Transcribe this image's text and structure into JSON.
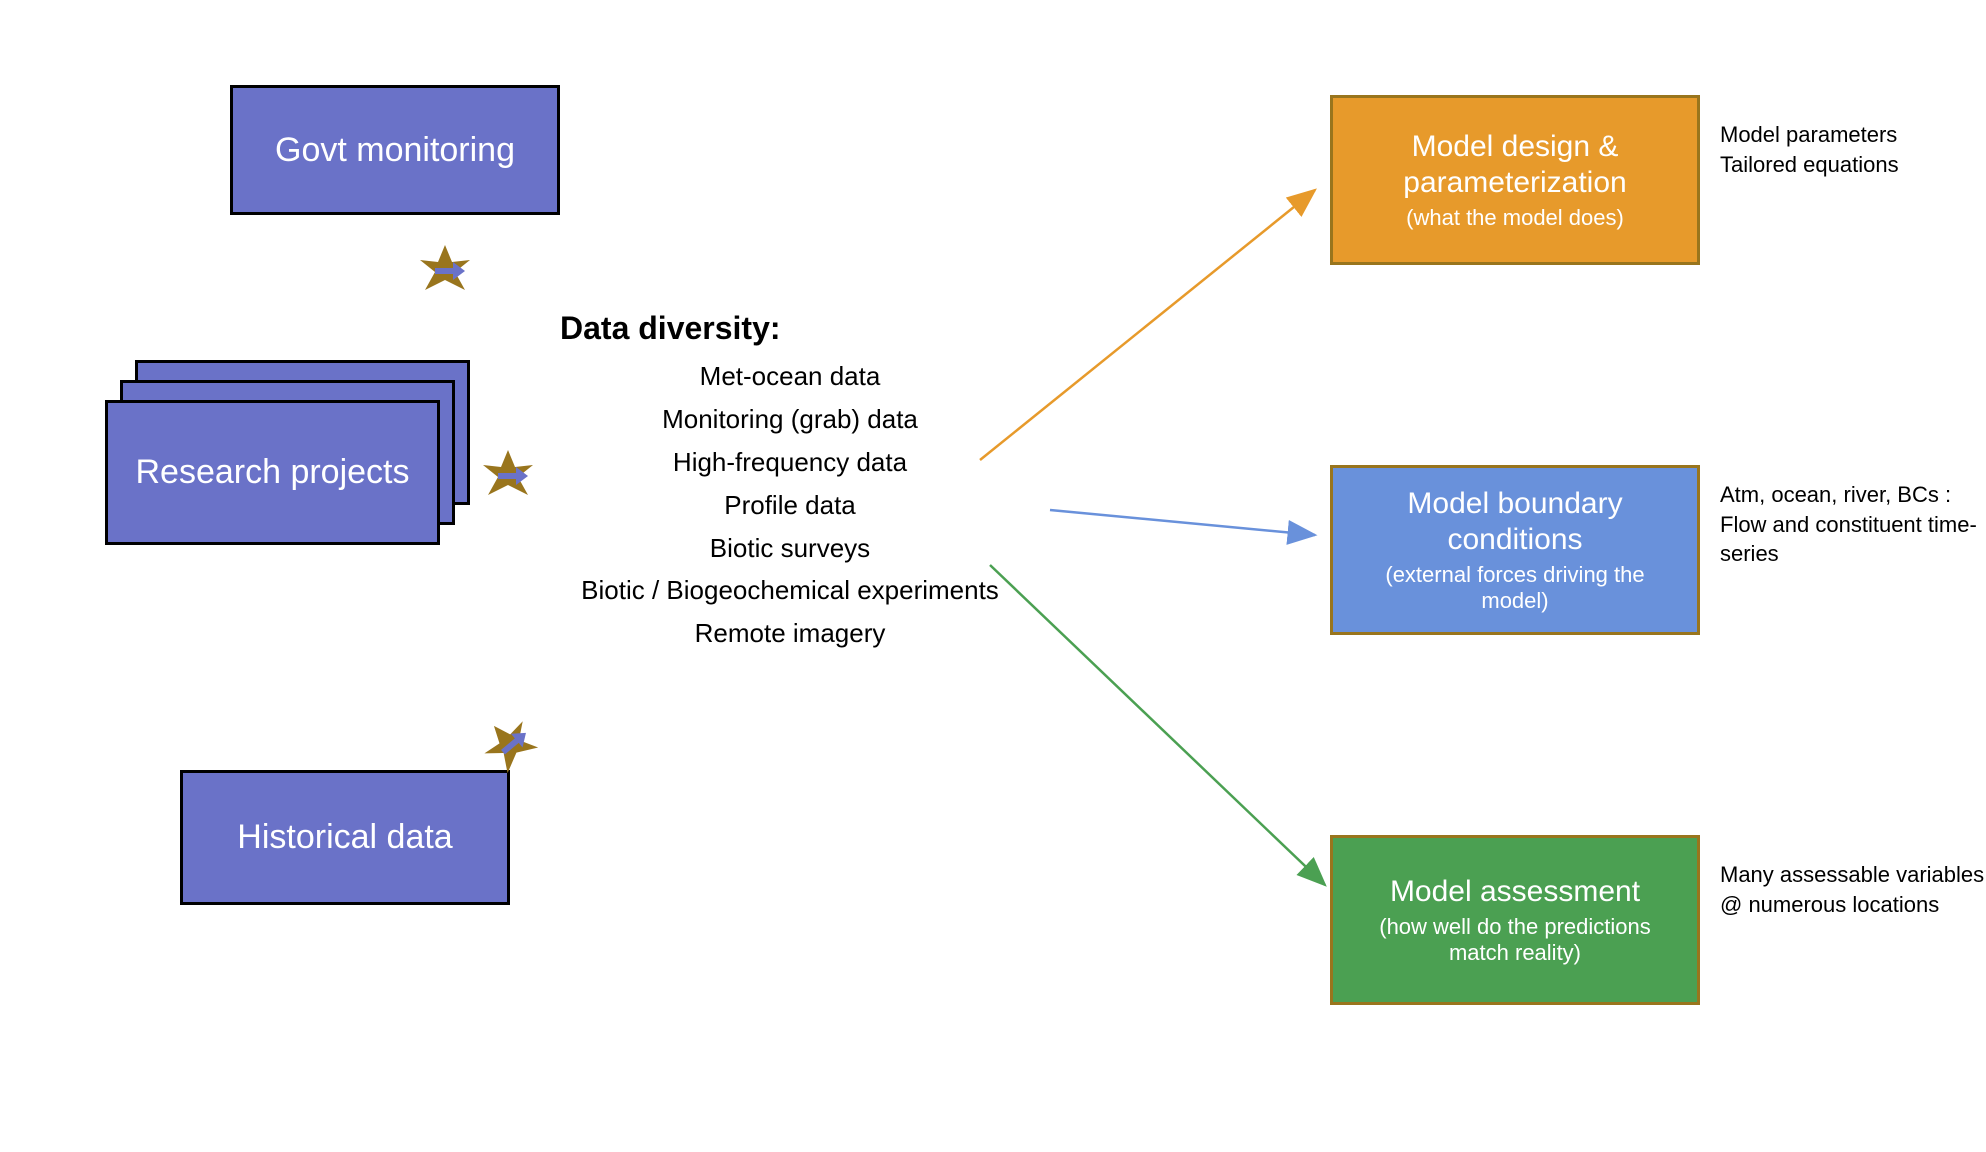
{
  "sources": {
    "govt": "Govt monitoring",
    "research": "Research projects",
    "historical": "Historical data"
  },
  "center": {
    "heading": "Data diversity:",
    "items": [
      "Met-ocean data",
      "Monitoring (grab) data",
      "High-frequency data",
      "Profile data",
      "Biotic surveys",
      "Biotic / Biogeochemical experiments",
      "Remote imagery"
    ]
  },
  "outputs": {
    "design": {
      "title": "Model design & parameterization",
      "subtitle": "(what the model does)",
      "annotation": "Model parameters\nTailored equations"
    },
    "boundary": {
      "title": "Model boundary conditions",
      "subtitle": "(external forces driving the model)",
      "annotation": "Atm, ocean, river, BCs :\nFlow and constituent time-series"
    },
    "assessment": {
      "title": "Model assessment",
      "subtitle": "(how well do the predictions match reality)",
      "annotation": "Many assessable variables\n@ numerous locations"
    }
  },
  "colors": {
    "purple": "#6a72c8",
    "orange": "#e79a2b",
    "blue": "#6991db",
    "green": "#4ba052",
    "olive": "#99751d"
  }
}
